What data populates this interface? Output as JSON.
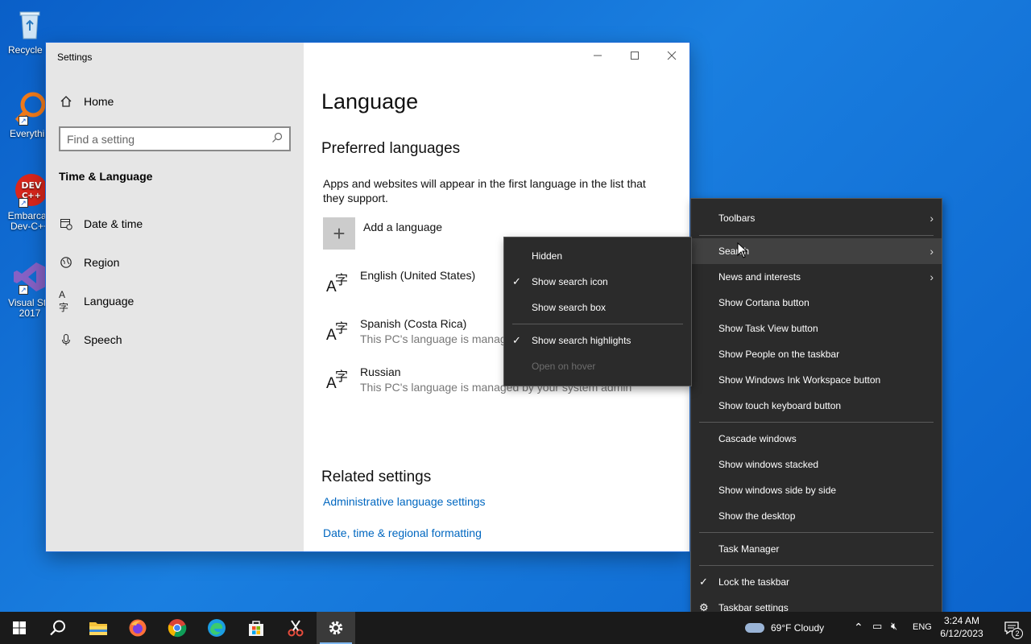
{
  "desktop": {
    "icons": [
      {
        "label": "Recycle B"
      },
      {
        "label": "Everythin"
      },
      {
        "label": "Embarcad",
        "label2": "Dev-C++"
      },
      {
        "label": "Visual Stu",
        "label2": "2017"
      }
    ]
  },
  "window": {
    "title": "Settings",
    "sidebar": {
      "home": "Home",
      "search_placeholder": "Find a setting",
      "section": "Time & Language",
      "items": [
        {
          "label": "Date & time"
        },
        {
          "label": "Region"
        },
        {
          "label": "Language"
        },
        {
          "label": "Speech"
        }
      ]
    },
    "content": {
      "title": "Language",
      "preferred_heading": "Preferred languages",
      "description": "Apps and websites will appear in the first language in the list that they support.",
      "add_language": "Add a language",
      "languages": [
        {
          "name": "English (United States)",
          "sub": ""
        },
        {
          "name": "Spanish (Costa Rica)",
          "sub": "This PC's language is manage"
        },
        {
          "name": "Russian",
          "sub": "This PC's language is managed by your system admin"
        }
      ],
      "related_heading": "Related settings",
      "links": [
        "Administrative language settings",
        "Date, time & regional formatting"
      ]
    }
  },
  "search_submenu": {
    "items": [
      {
        "label": "Hidden",
        "checked": false,
        "disabled": false
      },
      {
        "label": "Show search icon",
        "checked": true,
        "disabled": false
      },
      {
        "label": "Show search box",
        "checked": false,
        "disabled": false
      },
      {
        "label": "Show search highlights",
        "checked": true,
        "disabled": false
      },
      {
        "label": "Open on hover",
        "checked": false,
        "disabled": true
      }
    ]
  },
  "taskbar_menu": {
    "items": [
      {
        "label": "Toolbars"
      },
      {
        "label": "Search"
      },
      {
        "label": "News and interests"
      },
      {
        "label": "Show Cortana button"
      },
      {
        "label": "Show Task View button"
      },
      {
        "label": "Show People on the taskbar"
      },
      {
        "label": "Show Windows Ink Workspace button"
      },
      {
        "label": "Show touch keyboard button"
      },
      {
        "label": "Cascade windows"
      },
      {
        "label": "Show windows stacked"
      },
      {
        "label": "Show windows side by side"
      },
      {
        "label": "Show the desktop"
      },
      {
        "label": "Task Manager"
      },
      {
        "label": "Lock the taskbar"
      },
      {
        "label": "Taskbar settings"
      }
    ]
  },
  "taskbar": {
    "weather": "69°F Cloudy",
    "lang": "ENG",
    "time": "3:24 AM",
    "date": "6/12/2023",
    "notification_count": "2"
  },
  "colors": {
    "accent": "#0067c0",
    "menu_bg": "#2b2b2b",
    "taskbar_bg": "#1a1a1a"
  }
}
